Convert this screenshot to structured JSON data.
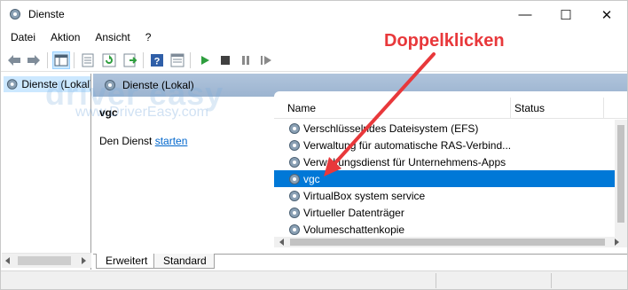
{
  "window": {
    "title": "Dienste",
    "min_glyph": "—",
    "max_glyph": "☐",
    "close_glyph": "✕"
  },
  "menu": [
    "Datei",
    "Aktion",
    "Ansicht",
    "?"
  ],
  "toolbar": {
    "icons": [
      "back-icon",
      "forward-icon",
      "show-tree-icon",
      "properties-icon",
      "refresh-icon",
      "export-icon",
      "help-icon",
      "console-icon",
      "start-icon",
      "stop-icon",
      "pause-icon",
      "restart-icon"
    ]
  },
  "tree": {
    "item_label": "Dienste (Lokal)"
  },
  "right_header": {
    "label": "Dienste (Lokal)"
  },
  "detail": {
    "service_name": "vgc",
    "text_prefix": "Den Dienst ",
    "link_text": "starten"
  },
  "list": {
    "columns": {
      "name": "Name",
      "status": "Status"
    },
    "rows": [
      {
        "name": "Verschlüsselndes Dateisystem (EFS)",
        "selected": false
      },
      {
        "name": "Verwaltung für automatische RAS-Verbind...",
        "selected": false
      },
      {
        "name": "Verwaltungsdienst für Unternehmens-Apps",
        "selected": false
      },
      {
        "name": "vgc",
        "selected": true
      },
      {
        "name": "VirtualBox system service",
        "selected": false
      },
      {
        "name": "Virtueller Datenträger",
        "selected": false
      },
      {
        "name": "Volumeschattenkopie",
        "selected": false
      }
    ]
  },
  "tabs": [
    "Erweitert",
    "Standard"
  ],
  "watermark": {
    "logo": "driver easy",
    "url": "www.DriverEasy.com"
  },
  "annotation": {
    "text": "Doppelklicken",
    "color": "#e8383b"
  },
  "colors": {
    "selection": "#0078d7",
    "link": "#0066cc",
    "header": "#a8bdd6"
  }
}
